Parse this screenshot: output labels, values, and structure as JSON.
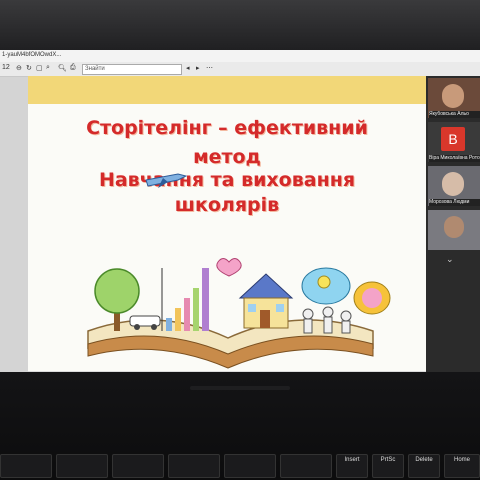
{
  "window": {
    "doc_title": "1-yauM4bfOMOwdX..."
  },
  "toolbar": {
    "page": "12",
    "find_label": "Знайти"
  },
  "slide": {
    "title_line1": "Сторітелінг – ефективний",
    "title_line2": "метод",
    "title_line3": "Навчання та виховання",
    "title_line4": "школярів"
  },
  "participants": [
    {
      "name": "Якубовська Альо",
      "initial": ""
    },
    {
      "name": "Віра Миколаївна Рото",
      "initial": "В"
    },
    {
      "name": "Морозова Людми",
      "initial": ""
    },
    {
      "name": "",
      "initial": ""
    }
  ],
  "keyboard": {
    "keys": [
      "Insert",
      "PrtSc",
      "Delete",
      "Home"
    ]
  },
  "colors": {
    "title_red": "#d42a2a",
    "band_yellow": "#f2d778",
    "avatar_red": "#d9372b"
  }
}
